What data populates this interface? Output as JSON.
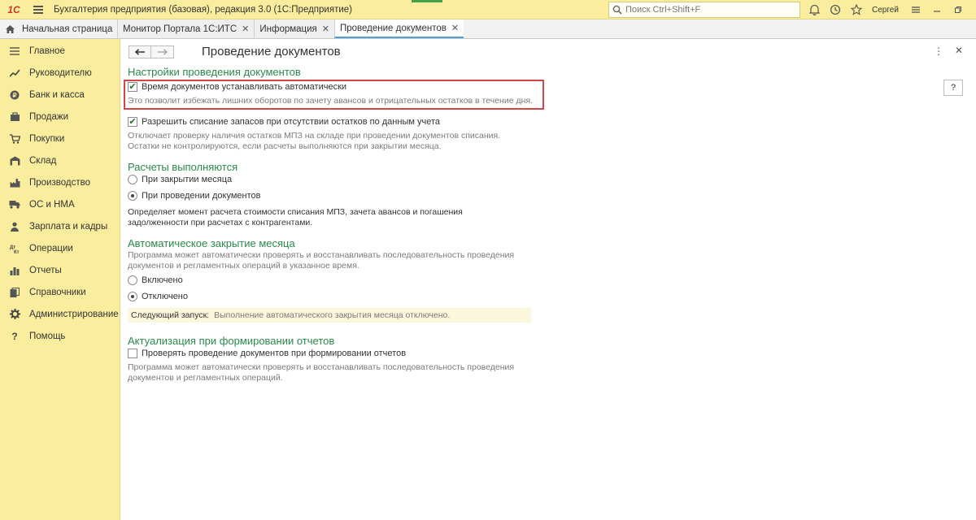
{
  "app": {
    "title": "Бухгалтерия предприятия (базовая), редакция 3.0  (1С:Предприятие)",
    "logo": "1С",
    "search_placeholder": "Поиск Ctrl+Shift+F",
    "user": "Сергей"
  },
  "tabs": {
    "home": "Начальная страница",
    "items": [
      {
        "label": "Монитор Портала 1С:ИТС"
      },
      {
        "label": "Информация"
      },
      {
        "label": "Проведение документов"
      }
    ]
  },
  "sidebar": {
    "items": [
      {
        "label": "Главное",
        "icon": "menu-icon"
      },
      {
        "label": "Руководителю",
        "icon": "trend-icon"
      },
      {
        "label": "Банк и касса",
        "icon": "coin-icon"
      },
      {
        "label": "Продажи",
        "icon": "sales-icon"
      },
      {
        "label": "Покупки",
        "icon": "cart-icon"
      },
      {
        "label": "Склад",
        "icon": "warehouse-icon"
      },
      {
        "label": "Производство",
        "icon": "factory-icon"
      },
      {
        "label": "ОС и НМА",
        "icon": "truck-icon"
      },
      {
        "label": "Зарплата и кадры",
        "icon": "person-icon"
      },
      {
        "label": "Операции",
        "icon": "dt-kt-icon"
      },
      {
        "label": "Отчеты",
        "icon": "chart-icon"
      },
      {
        "label": "Справочники",
        "icon": "books-icon"
      },
      {
        "label": "Администрирование",
        "icon": "gear-icon"
      },
      {
        "label": "Помощь",
        "icon": "question-icon"
      }
    ]
  },
  "page": {
    "title": "Проведение документов",
    "help": "?",
    "settings": {
      "header": "Настройки проведения документов",
      "auto_time_label": "Время документов устанавливать автоматически",
      "auto_time_checked": true,
      "auto_time_desc": "Это позволит избежать лишних оборотов по зачету авансов и отрицательных остатков в течение дня.",
      "writeoff_label": "Разрешить списание запасов при отсутствии остатков по данным учета",
      "writeoff_checked": true,
      "writeoff_desc_1": "Отключает проверку наличия остатков МПЗ на складе при проведении документов списания.",
      "writeoff_desc_2": "Остатки не контролируются, если расчеты выполняются при закрытии месяца."
    },
    "calc": {
      "header": "Расчеты выполняются",
      "option_1": "При закрытии месяца",
      "option_2": "При проведении документов",
      "selected": 2,
      "desc_1": "Определяет момент расчета стоимости списания МПЗ, зачета авансов и погашения",
      "desc_2": "задолженности при расчетах с контрагентами."
    },
    "auto_close": {
      "header": "Автоматическое закрытие месяца",
      "desc_1": "Программа может автоматически проверять и восстанавливать последовательность проведения",
      "desc_2": "документов и регламентных операций в указанное время.",
      "option_on": "Включено",
      "option_off": "Отключено",
      "selected": "off",
      "next_run_label": "Следующий запуск:",
      "next_run_value": "Выполнение автоматического закрытия месяца отключено."
    },
    "refresh": {
      "header": "Актуализация при формировании отчетов",
      "check_label": "Проверять проведение документов при формировании отчетов",
      "checked": false,
      "desc_1": "Программа может автоматически проверять и восстанавливать последовательность проведения",
      "desc_2": "документов и регламентных операций."
    }
  }
}
